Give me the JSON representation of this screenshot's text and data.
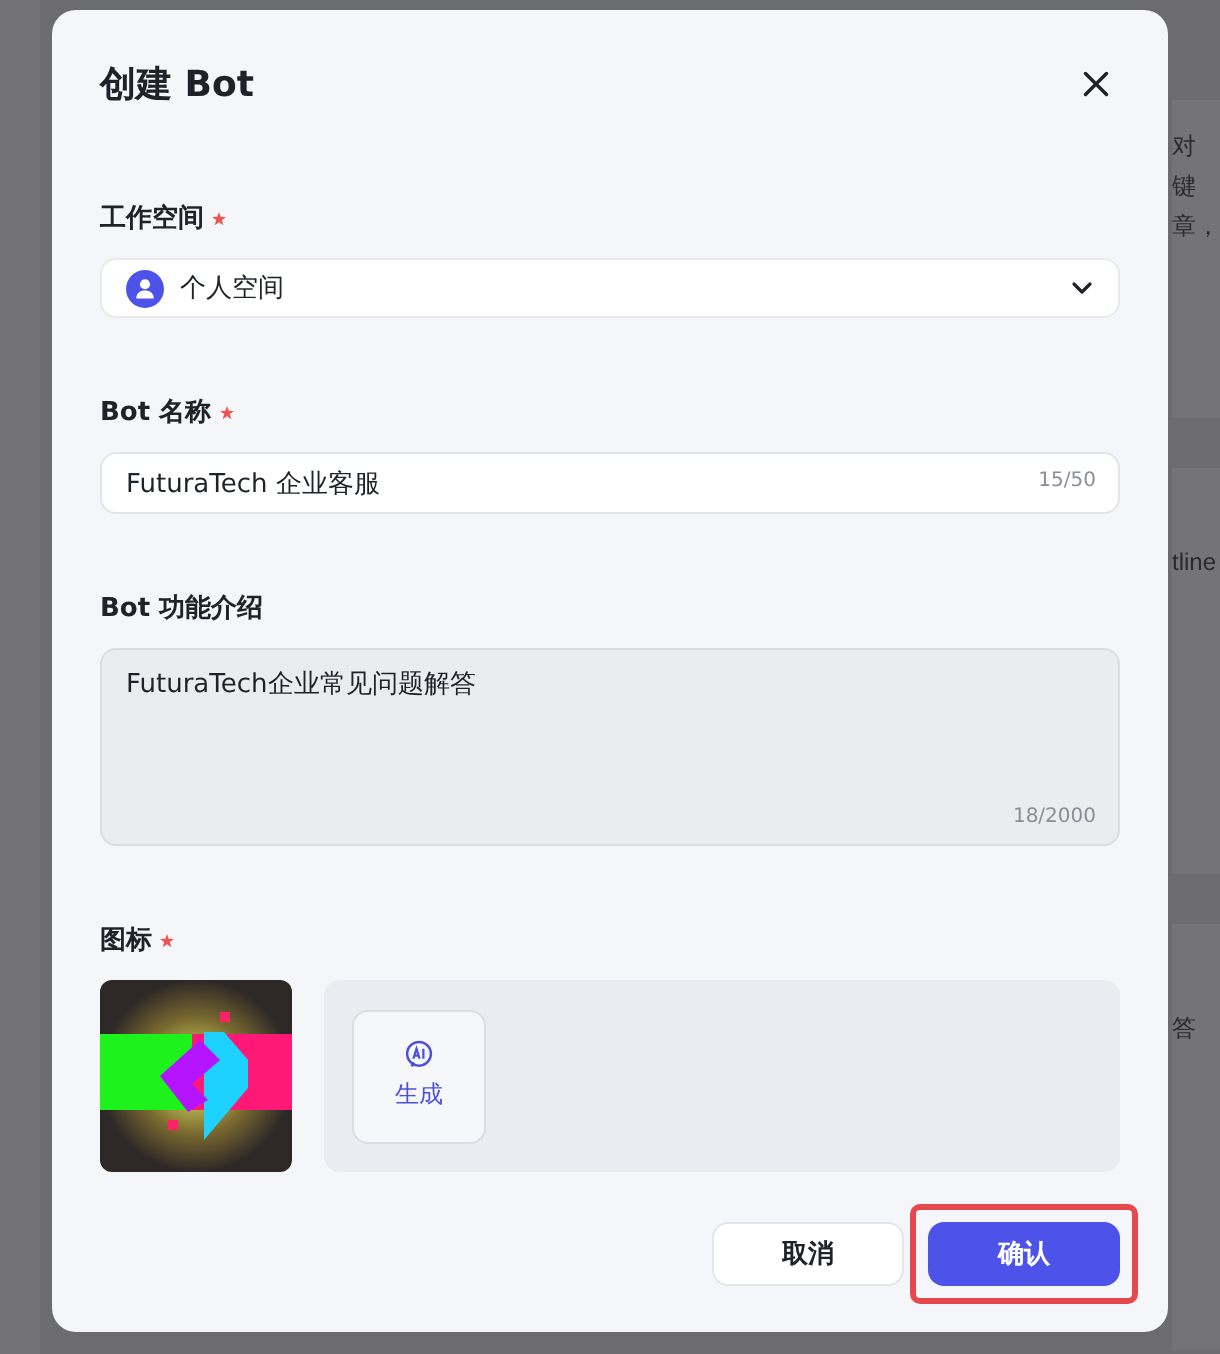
{
  "background_texts": [
    "对",
    "键",
    "章，",
    "tline",
    "答"
  ],
  "dialog": {
    "title": "创建 Bot",
    "fields": [
      {
        "kind": "select",
        "label": "工作空间",
        "required": true,
        "value": "个人空间"
      },
      {
        "kind": "text",
        "label": "Bot 名称",
        "required": true,
        "value": "FuturaTech 企业客服",
        "counter": "15/50"
      },
      {
        "kind": "textarea",
        "label": "Bot 功能介绍",
        "required": false,
        "value": "FuturaTech企业常见问题解答",
        "counter": "18/2000"
      }
    ],
    "icon_field": {
      "label": "图标",
      "required": true,
      "generate_label": "生成"
    },
    "buttons": [
      {
        "label": "取消",
        "kind": "secondary",
        "highlighted": false
      },
      {
        "label": "确认",
        "kind": "primary",
        "highlighted": true
      }
    ]
  }
}
